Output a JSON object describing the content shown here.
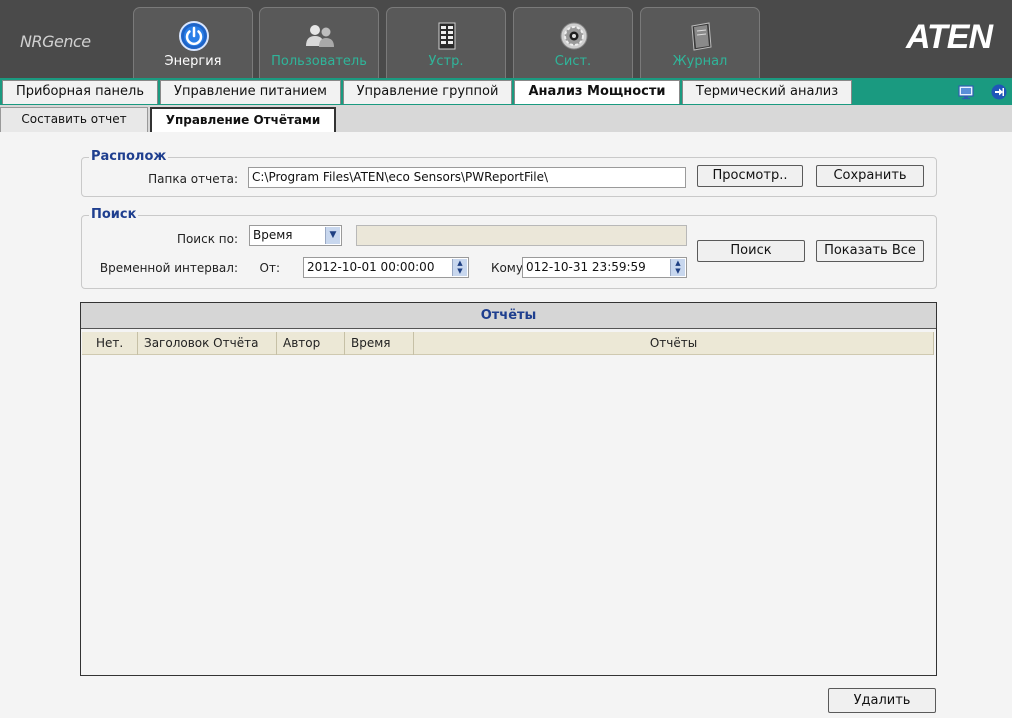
{
  "brand": {
    "left": "NRGence",
    "right": "ATEN"
  },
  "main_tabs": [
    {
      "label": "Энергия",
      "icon": "power-icon"
    },
    {
      "label": "Пользователь",
      "icon": "users-icon"
    },
    {
      "label": "Устр.",
      "icon": "device-rack-icon"
    },
    {
      "label": "Сист.",
      "icon": "system-gear-icon"
    },
    {
      "label": "Журнал",
      "icon": "log-book-icon"
    }
  ],
  "sub_tabs": [
    {
      "label": "Приборная панель"
    },
    {
      "label": "Управление питанием"
    },
    {
      "label": "Управление группой"
    },
    {
      "label": "Анализ Мощности"
    },
    {
      "label": "Термический анализ"
    }
  ],
  "third_tabs": [
    {
      "label": "Составить отчет"
    },
    {
      "label": "Управление Отчётами"
    }
  ],
  "location": {
    "title": "Располож",
    "folder_label": "Папка отчета:",
    "folder_value": "C:\\Program Files\\ATEN\\eco Sensors\\PWReportFile\\",
    "browse_label": "Просмотр..",
    "save_label": "Сохранить"
  },
  "search": {
    "title": "Поиск",
    "by_label": "Поиск по:",
    "by_value": "Время",
    "text_value": "",
    "interval_label": "Временной интервал:",
    "from_label": "От:",
    "from_value": "2012-10-01 00:00:00",
    "to_label": "Кому:",
    "to_value": "012-10-31 23:59:59",
    "search_label": "Поиск",
    "show_all_label": "Показать Все"
  },
  "reports": {
    "title": "Отчёты",
    "columns": [
      "Нет.",
      "Заголовок Отчёта",
      "Автор",
      "Время",
      "Отчёты"
    ],
    "rows": []
  },
  "footer": {
    "delete_label": "Удалить"
  },
  "colors": {
    "header": "#4a4a4a",
    "accent_teal": "#1a9a80",
    "title_blue": "#1f3f8f"
  }
}
